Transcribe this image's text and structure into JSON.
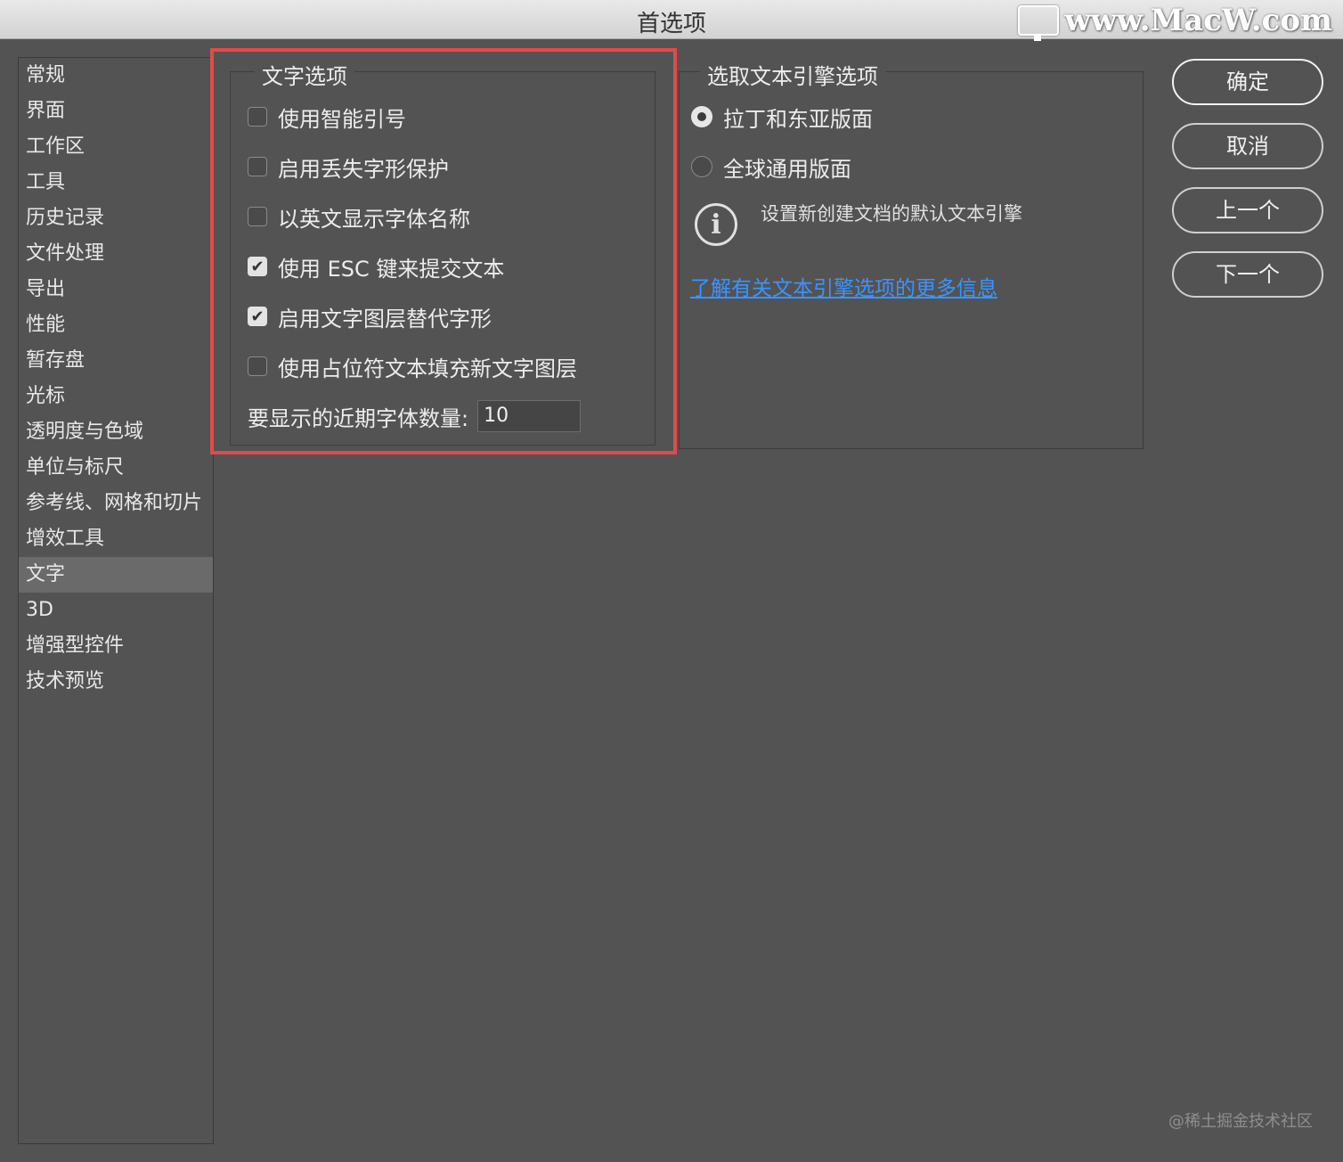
{
  "window": {
    "title": "首选项"
  },
  "watermark": {
    "site": "www.MacW.com",
    "footer": "@稀土掘金技术社区"
  },
  "sidebar": {
    "items": [
      {
        "label": "常规"
      },
      {
        "label": "界面"
      },
      {
        "label": "工作区"
      },
      {
        "label": "工具"
      },
      {
        "label": "历史记录"
      },
      {
        "label": "文件处理"
      },
      {
        "label": "导出"
      },
      {
        "label": "性能"
      },
      {
        "label": "暂存盘"
      },
      {
        "label": "光标"
      },
      {
        "label": "透明度与色域"
      },
      {
        "label": "单位与标尺"
      },
      {
        "label": "参考线、网格和切片"
      },
      {
        "label": "增效工具"
      },
      {
        "label": "文字",
        "selected": true
      },
      {
        "label": "3D"
      },
      {
        "label": "增强型控件"
      },
      {
        "label": "技术预览"
      }
    ]
  },
  "text_options": {
    "title": "文字选项",
    "checkboxes": [
      {
        "label": "使用智能引号",
        "checked": false
      },
      {
        "label": "启用丢失字形保护",
        "checked": false
      },
      {
        "label": "以英文显示字体名称",
        "checked": false
      },
      {
        "label": "使用 ESC 键来提交文本",
        "checked": true
      },
      {
        "label": "启用文字图层替代字形",
        "checked": true
      },
      {
        "label": "使用占位符文本填充新文字图层",
        "checked": false
      }
    ],
    "recent_fonts_label": "要显示的近期字体数量:",
    "recent_fonts_value": "10",
    "checkmark_glyph": "✔"
  },
  "engine_options": {
    "title": "选取文本引擎选项",
    "radios": [
      {
        "label": "拉丁和东亚版面",
        "selected": true
      },
      {
        "label": "全球通用版面",
        "selected": false
      }
    ],
    "info_glyph": "i",
    "info_text": "设置新创建文档的默认文本引擎",
    "link": "了解有关文本引擎选项的更多信息"
  },
  "buttons": {
    "ok": "确定",
    "cancel": "取消",
    "prev": "上一个",
    "next": "下一个"
  },
  "colors": {
    "background": "#535353",
    "highlight": "#e34a4a",
    "link": "#3b93ff"
  }
}
